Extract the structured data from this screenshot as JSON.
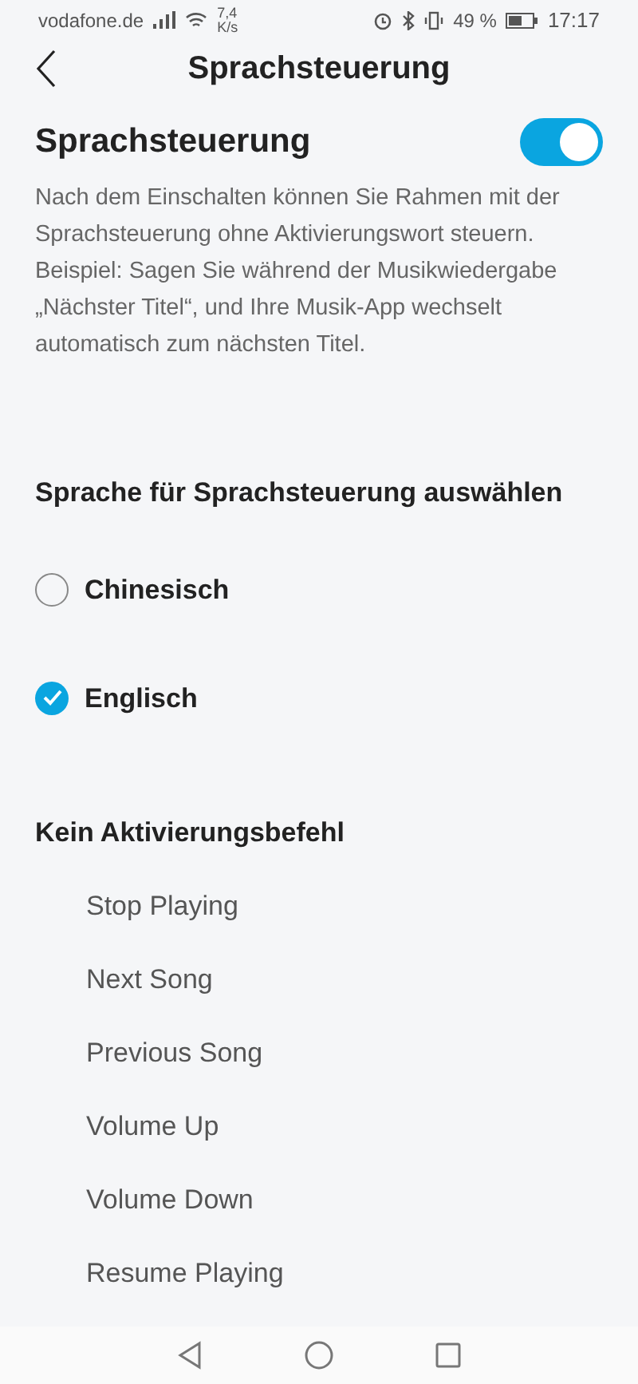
{
  "status_bar": {
    "carrier": "vodafone.de",
    "speed": "7,4",
    "speed_unit": "K/s",
    "battery": "49 %",
    "time": "17:17"
  },
  "header": {
    "title": "Sprachsteuerung"
  },
  "voice_control": {
    "label": "Sprachsteuerung",
    "on": true,
    "description": "Nach dem Einschalten können Sie Rahmen mit der Sprachsteuerung ohne Aktivierungswort steuern. Beispiel: Sagen Sie während der Musikwiedergabe „Nächster Titel“, und Ihre Musik-App wechselt automatisch zum nächsten Titel."
  },
  "language_section": {
    "title": "Sprache für Sprachsteuerung auswählen",
    "options": [
      {
        "label": "Chinesisch",
        "selected": false
      },
      {
        "label": "Englisch",
        "selected": true
      }
    ]
  },
  "commands_section": {
    "title": "Kein Aktivierungsbefehl",
    "commands": [
      "Stop Playing",
      "Next Song",
      "Previous Song",
      "Volume Up",
      "Volume Down",
      "Resume Playing"
    ]
  }
}
